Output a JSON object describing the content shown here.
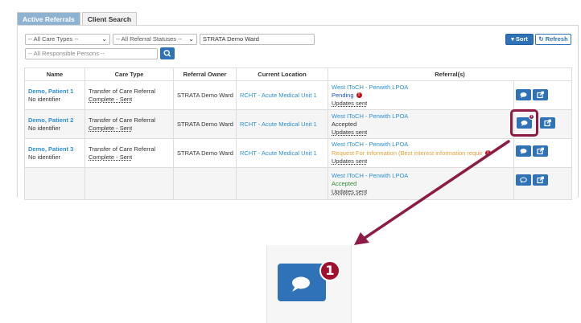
{
  "tabs": [
    {
      "label": "Active Referrals",
      "active": true
    },
    {
      "label": "Client Search",
      "active": false
    }
  ],
  "filters": {
    "care_types": "-- All Care Types --",
    "statuses": "-- All Referral Statuses --",
    "ward": "STRATA Demo Ward",
    "persons_placeholder": "-- All Responsible Persons --"
  },
  "toolbar": {
    "sort_label": "Sort",
    "refresh_label": "Refresh"
  },
  "table": {
    "headers": [
      "Name",
      "Care Type",
      "Referral Owner",
      "Current Location",
      "Referral(s)"
    ],
    "rows": [
      {
        "name": "Demo, Patient 1",
        "identifier": "No identifier",
        "care_type_1": "Transfer of Care Referral",
        "care_type_2": "Complete - Sent",
        "owner": "STRATA Demo Ward",
        "location": "RCHT - Acute Medical Unit 1",
        "ref_org": "West IToCH - Penwith LPOA",
        "ref_status": "Pending",
        "ref_updates": "Updates sent"
      },
      {
        "name": "Demo, Patient 2",
        "identifier": "No identifier",
        "care_type_1": "Transfer of Care Referral",
        "care_type_2": "Complete - Sent",
        "owner": "STRATA Demo Ward",
        "location": "RCHT - Acute Medical Unit 1",
        "ref_org": "West IToCH - Penwith LPOA",
        "ref_status": "Accepted",
        "ref_updates": "Updates sent"
      },
      {
        "name": "Demo, Patient 3",
        "identifier": "No identifier",
        "care_type_1": "Transfer of Care Referral",
        "care_type_2": "Complete - Sent",
        "owner": "STRATA Demo Ward",
        "location": "RCHT - Acute Medical Unit 1",
        "ref_org": "West IToCH - Penwith LPOA",
        "ref_status": "Request For Information (Best interest information requir",
        "ref_updates": "Updates sent"
      },
      {
        "name": "",
        "identifier": "",
        "care_type_1": "",
        "care_type_2": "",
        "owner": "",
        "location": "",
        "ref_org": "West IToCH - Penwith LPOA",
        "ref_status": "Accepted",
        "ref_updates": "Updates sent"
      }
    ]
  },
  "badge": {
    "count": "1"
  },
  "zoom": {
    "badge_count": "1"
  },
  "colors": {
    "accent": "#2f72b8",
    "highlight": "#8d1b45",
    "badge": "#a1112d",
    "warning": "#c0151d"
  }
}
